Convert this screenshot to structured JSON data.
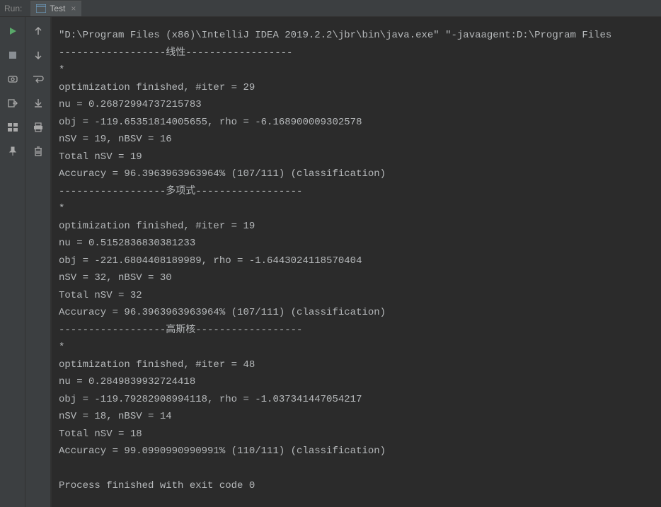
{
  "header": {
    "run_label": "Run:",
    "tab_name": "Test",
    "close_symbol": "×"
  },
  "console": {
    "lines": [
      "\"D:\\Program Files (x86)\\IntelliJ IDEA 2019.2.2\\jbr\\bin\\java.exe\" \"-javaagent:D:\\Program Files ",
      "------------------线性------------------",
      "*",
      "optimization finished, #iter = 29",
      "nu = 0.26872994737215783",
      "obj = -119.65351814005655, rho = -6.168900009302578",
      "nSV = 19, nBSV = 16",
      "Total nSV = 19",
      "Accuracy = 96.3963963963964% (107/111) (classification)",
      "------------------多项式------------------",
      "*",
      "optimization finished, #iter = 19",
      "nu = 0.5152836830381233",
      "obj = -221.6804408189989, rho = -1.6443024118570404",
      "nSV = 32, nBSV = 30",
      "Total nSV = 32",
      "Accuracy = 96.3963963963964% (107/111) (classification)",
      "------------------高斯核------------------",
      "*",
      "optimization finished, #iter = 48",
      "nu = 0.2849839932724418",
      "obj = -119.79282908994118, rho = -1.037341447054217",
      "nSV = 18, nBSV = 14",
      "Total nSV = 18",
      "Accuracy = 99.0990990990991% (110/111) (classification)",
      "",
      "Process finished with exit code 0"
    ]
  }
}
